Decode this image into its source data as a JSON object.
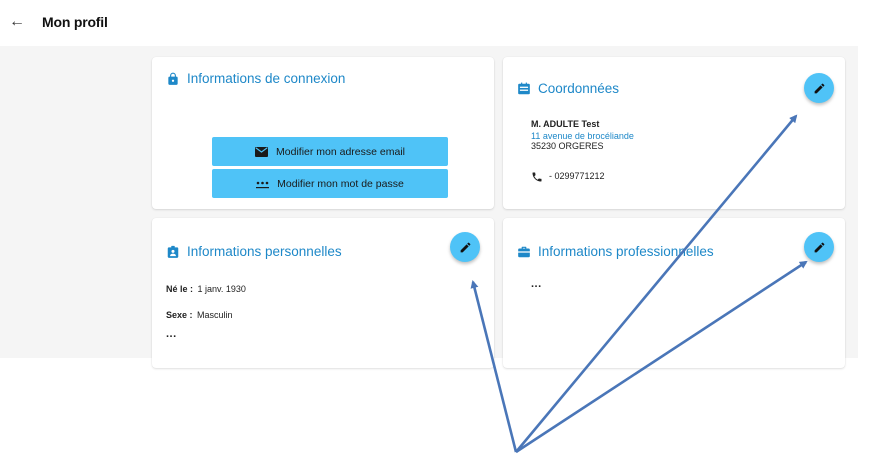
{
  "header": {
    "back_icon": "arrow-left-icon",
    "title": "Mon profil"
  },
  "connexion": {
    "title": "Informations de connexion",
    "icon": "lock-icon",
    "email_button": "Modifier mon adresse email",
    "email_icon": "envelope-icon",
    "password_button": "Modifier mon mot de passe",
    "password_icon": "password-dots-icon"
  },
  "coordonnees": {
    "title": "Coordonnées",
    "icon": "contact-card-icon",
    "name": "M. ADULTE Test",
    "address_line1": "11 avenue de brocéliande",
    "address_line2": "35230 ORGERES",
    "phone": "- 0299771212",
    "phone_icon": "phone-icon"
  },
  "personnelles": {
    "title": "Informations personnelles",
    "icon": "id-badge-icon",
    "birth_label": "Né le :",
    "birth_value": "1 janv. 1930",
    "sex_label": "Sexe :",
    "sex_value": "Masculin",
    "more": "..."
  },
  "professionnelles": {
    "title": "Informations professionnelles",
    "icon": "briefcase-icon",
    "more": "..."
  },
  "edit_icon": "pencil-icon",
  "colors": {
    "accent": "#1e88c8",
    "button": "#4fc3f7",
    "background": "#f5f5f5",
    "arrow": "#4a76b8"
  }
}
